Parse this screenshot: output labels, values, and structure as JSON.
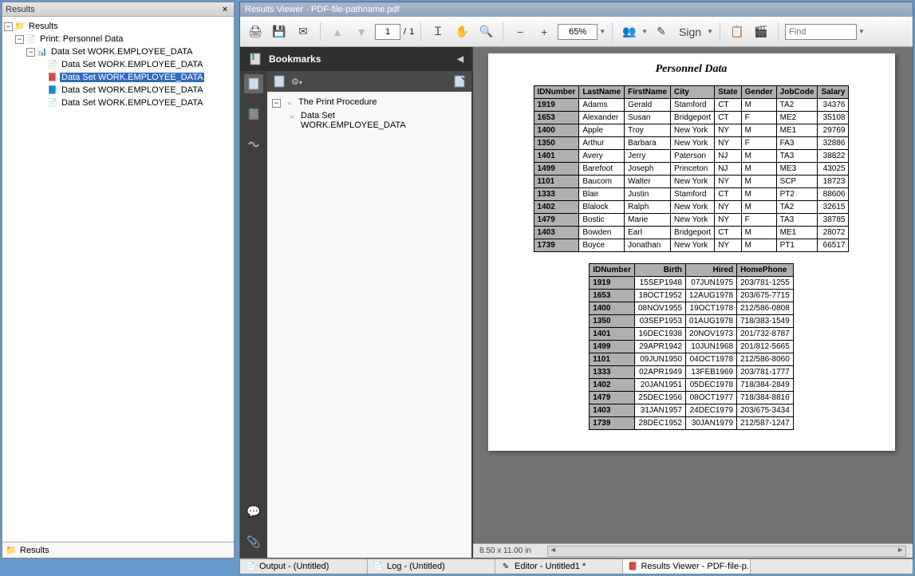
{
  "results_panel": {
    "title": "Results",
    "tree": {
      "root": "Results",
      "print_node": "Print:  Personnel Data",
      "dataset_node": "Data Set WORK.EMPLOYEE_DATA",
      "children": [
        "Data Set WORK.EMPLOYEE_DATA",
        "Data Set WORK.EMPLOYEE_DATA",
        "Data Set WORK.EMPLOYEE_DATA",
        "Data Set WORK.EMPLOYEE_DATA"
      ],
      "selected_index": 1
    },
    "bottom_tab": "Results"
  },
  "viewer": {
    "title": "Results Viewer - PDF-file-pathname.pdf",
    "toolbar": {
      "page_current": "1",
      "page_sep": "/",
      "page_total": "1",
      "zoom": "65%",
      "sign_label": "Sign",
      "find_placeholder": "Find"
    },
    "bookmarks": {
      "header": "Bookmarks",
      "root": "The Print Procedure",
      "child_line1": "Data Set",
      "child_line2": "WORK.EMPLOYEE_DATA"
    },
    "pdf": {
      "title": "Personnel Data",
      "table1_headers": [
        "IDNumber",
        "LastName",
        "FirstName",
        "City",
        "State",
        "Gender",
        "JobCode",
        "Salary"
      ],
      "table1_rows": [
        [
          "1919",
          "Adams",
          "Gerald",
          "Stamford",
          "CT",
          "M",
          "TA2",
          "34376"
        ],
        [
          "1653",
          "Alexander",
          "Susan",
          "Bridgeport",
          "CT",
          "F",
          "ME2",
          "35108"
        ],
        [
          "1400",
          "Apple",
          "Troy",
          "New York",
          "NY",
          "M",
          "ME1",
          "29769"
        ],
        [
          "1350",
          "Arthur",
          "Barbara",
          "New York",
          "NY",
          "F",
          "FA3",
          "32886"
        ],
        [
          "1401",
          "Avery",
          "Jerry",
          "Paterson",
          "NJ",
          "M",
          "TA3",
          "38822"
        ],
        [
          "1499",
          "Barefoot",
          "Joseph",
          "Princeton",
          "NJ",
          "M",
          "ME3",
          "43025"
        ],
        [
          "1101",
          "Baucom",
          "Walter",
          "New York",
          "NY",
          "M",
          "SCP",
          "18723"
        ],
        [
          "1333",
          "Blair",
          "Justin",
          "Stamford",
          "CT",
          "M",
          "PT2",
          "88606"
        ],
        [
          "1402",
          "Blalock",
          "Ralph",
          "New York",
          "NY",
          "M",
          "TA2",
          "32615"
        ],
        [
          "1479",
          "Bostic",
          "Marie",
          "New York",
          "NY",
          "F",
          "TA3",
          "38785"
        ],
        [
          "1403",
          "Bowden",
          "Earl",
          "Bridgeport",
          "CT",
          "M",
          "ME1",
          "28072"
        ],
        [
          "1739",
          "Boyce",
          "Jonathan",
          "New York",
          "NY",
          "M",
          "PT1",
          "66517"
        ]
      ],
      "table2_headers": [
        "IDNumber",
        "Birth",
        "Hired",
        "HomePhone"
      ],
      "table2_rows": [
        [
          "1919",
          "15SEP1948",
          "07JUN1975",
          "203/781-1255"
        ],
        [
          "1653",
          "18OCT1952",
          "12AUG1978",
          "203/675-7715"
        ],
        [
          "1400",
          "08NOV1955",
          "19OCT1978",
          "212/586-0808"
        ],
        [
          "1350",
          "03SEP1953",
          "01AUG1978",
          "718/383-1549"
        ],
        [
          "1401",
          "16DEC1938",
          "20NOV1973",
          "201/732-8787"
        ],
        [
          "1499",
          "29APR1942",
          "10JUN1968",
          "201/812-5665"
        ],
        [
          "1101",
          "09JUN1950",
          "04OCT1978",
          "212/586-8060"
        ],
        [
          "1333",
          "02APR1949",
          "13FEB1969",
          "203/781-1777"
        ],
        [
          "1402",
          "20JAN1951",
          "05DEC1978",
          "718/384-2849"
        ],
        [
          "1479",
          "25DEC1956",
          "08OCT1977",
          "718/384-8816"
        ],
        [
          "1403",
          "31JAN1957",
          "24DEC1979",
          "203/675-3434"
        ],
        [
          "1739",
          "28DEC1952",
          "30JAN1979",
          "212/587-1247"
        ]
      ],
      "page_size": "8.50 x 11.00 in"
    }
  },
  "bottombar": {
    "tabs": [
      "Output - (Untitled)",
      "Log - (Untitled)",
      "Editor - Untitled1 *",
      "Results Viewer - PDF-file-p..."
    ],
    "active_index": 3
  }
}
